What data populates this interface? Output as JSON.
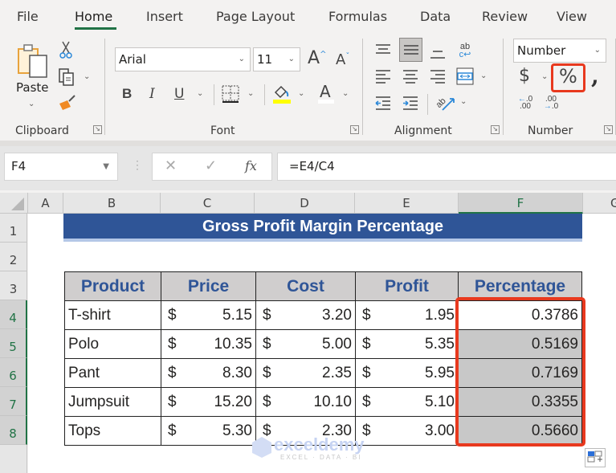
{
  "tabs": [
    "File",
    "Home",
    "Insert",
    "Page Layout",
    "Formulas",
    "Data",
    "Review",
    "View"
  ],
  "active_tab": "Home",
  "ribbon": {
    "clipboard": {
      "label": "Clipboard",
      "paste_label": "Paste"
    },
    "font": {
      "label": "Font",
      "font_name": "Arial",
      "font_size": "11",
      "bold": "B",
      "italic": "I",
      "underline": "U"
    },
    "alignment": {
      "label": "Alignment"
    },
    "number": {
      "label": "Number",
      "format": "Number",
      "currency": "$",
      "percent": "%",
      "comma": ","
    }
  },
  "formula_bar": {
    "name_box": "F4",
    "formula": "=E4/C4",
    "fx": "fx"
  },
  "columns": [
    "A",
    "B",
    "C",
    "D",
    "E",
    "F",
    "G"
  ],
  "selected_column": "F",
  "rows": [
    "1",
    "2",
    "3",
    "4",
    "5",
    "6",
    "7",
    "8"
  ],
  "sheet": {
    "title": "Gross Profit Margin Percentage",
    "headers": [
      "Product",
      "Price",
      "Cost",
      "Profit",
      "Percentage"
    ],
    "currency_symbol": "$",
    "rows": [
      {
        "product": "T-shirt",
        "price": "5.15",
        "cost": "3.20",
        "profit": "1.95",
        "percentage": "0.3786"
      },
      {
        "product": "Polo",
        "price": "10.35",
        "cost": "5.00",
        "profit": "5.35",
        "percentage": "0.5169"
      },
      {
        "product": "Pant",
        "price": "8.30",
        "cost": "2.35",
        "profit": "5.95",
        "percentage": "0.7169"
      },
      {
        "product": "Jumpsuit",
        "price": "15.20",
        "cost": "10.10",
        "profit": "5.10",
        "percentage": "0.3355"
      },
      {
        "product": "Tops",
        "price": "5.30",
        "cost": "2.30",
        "profit": "3.00",
        "percentage": "0.5660"
      }
    ]
  },
  "watermark": {
    "name": "exceldemy",
    "tagline": "EXCEL · DATA · BI"
  },
  "colors": {
    "accent": "#217346",
    "title_bg": "#2f5597",
    "highlight": "#e8391e"
  }
}
